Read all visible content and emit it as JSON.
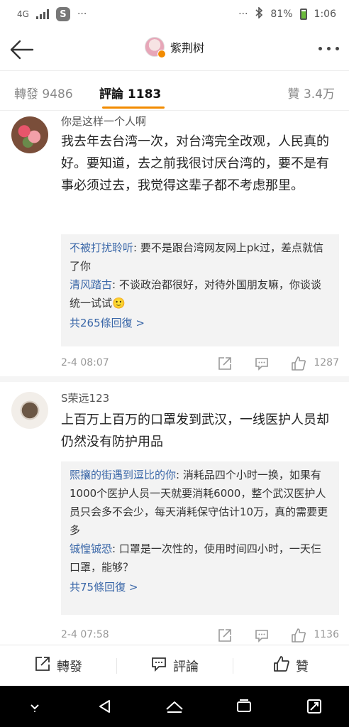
{
  "status_bar": {
    "network": "4G",
    "signal_text": "",
    "app_badge": "S",
    "dots_left": "···",
    "dots_right": "···",
    "battery_percent": "81%",
    "time": "1:06"
  },
  "nav": {
    "title": "紫荆树"
  },
  "tabs": {
    "repost": "轉發 9486",
    "comments": "評論 1183",
    "likes": "贊 3.4万"
  },
  "comments": [
    {
      "user": "你是这样一个人啊",
      "text": "我去年去台湾一次，对台湾完全改观，人民真的好。要知道，去之前我很讨厌台湾的，要不是有事必须过去，我觉得这辈子都不考虑那里。",
      "replies": [
        {
          "user": "不被打扰聆听",
          "text": "要不是跟台湾网友网上pk过，差点就信了你"
        },
        {
          "user": "清风踏古",
          "text": "不谈政治都很好，对待外国朋友嘛，你谈谈统一试试🙂"
        }
      ],
      "more_replies": "共265條回復 >",
      "time": "2-4 08:07",
      "likes": "1287"
    },
    {
      "user": "S荣远123",
      "text": "上百万上百万的口罩发到武汉，一线医护人员却仍然没有防护用品",
      "replies": [
        {
          "user": "熙攘的街遇到逗比的你",
          "text": "消耗品四个小时一换，如果有1000个医护人员一天就要消耗6000，整个武汉医护人员只会多不会少，每天消耗保守估计10万，真的需要更多"
        },
        {
          "user": "铖惶铖恐",
          "text": "口罩是一次性的，使用时间四小时，一天仨口罩，能够？"
        }
      ],
      "more_replies": "共75條回復 >",
      "time": "2-4 07:58",
      "likes": "1136"
    }
  ],
  "action_bar": {
    "repost": "轉發",
    "comment": "評論",
    "like": "贊"
  },
  "colors": {
    "accent": "#f28b00",
    "link": "#3a67a8"
  }
}
